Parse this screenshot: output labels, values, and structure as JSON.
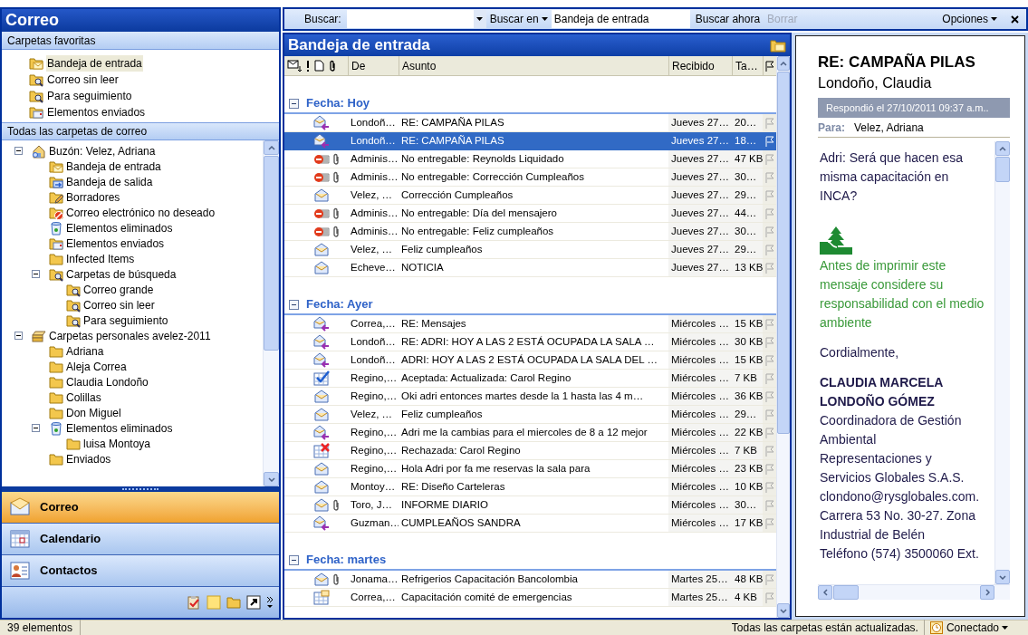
{
  "navigation_pane": {
    "title": "Correo",
    "favorites": {
      "title": "Carpetas favoritas",
      "items": [
        {
          "label": "Bandeja de entrada",
          "kind": "inbox",
          "selected": true
        },
        {
          "label": "Correo sin leer",
          "kind": "search",
          "selected": false
        },
        {
          "label": "Para seguimiento",
          "kind": "search",
          "selected": false
        },
        {
          "label": "Elementos enviados",
          "kind": "sent",
          "selected": false
        }
      ]
    },
    "all_folders": {
      "title": "Todas las carpetas de correo",
      "tree": [
        {
          "label": "Buzón: Velez, Adriana",
          "kind": "mailbox",
          "expanded": true,
          "children": [
            {
              "label": "Bandeja de entrada",
              "kind": "inbox"
            },
            {
              "label": "Bandeja de salida",
              "kind": "outbox"
            },
            {
              "label": "Borradores",
              "kind": "drafts"
            },
            {
              "label": "Correo electrónico no deseado",
              "kind": "junk"
            },
            {
              "label": "Elementos eliminados",
              "kind": "deleted"
            },
            {
              "label": "Elementos enviados",
              "kind": "sent"
            },
            {
              "label": "Infected Items",
              "kind": "folder"
            },
            {
              "label": "Carpetas de búsqueda",
              "kind": "search",
              "expanded": true,
              "children": [
                {
                  "label": "Correo grande",
                  "kind": "search"
                },
                {
                  "label": "Correo sin leer",
                  "kind": "search"
                },
                {
                  "label": "Para seguimiento",
                  "kind": "search"
                }
              ]
            }
          ]
        },
        {
          "label": "Carpetas personales avelez-2011",
          "kind": "pst",
          "expanded": true,
          "children": [
            {
              "label": "Adriana",
              "kind": "folder"
            },
            {
              "label": "Aleja Correa",
              "kind": "folder"
            },
            {
              "label": "Claudia Londoño",
              "kind": "folder"
            },
            {
              "label": "Colillas",
              "kind": "folder"
            },
            {
              "label": "Don Miguel",
              "kind": "folder"
            },
            {
              "label": "Elementos eliminados",
              "kind": "deleted",
              "expanded": true,
              "children": [
                {
                  "label": "luisa Montoya",
                  "kind": "folder"
                }
              ]
            },
            {
              "label": "Enviados",
              "kind": "folder"
            }
          ]
        }
      ]
    },
    "buttons": [
      {
        "label": "Correo",
        "kind": "mail",
        "selected": true
      },
      {
        "label": "Calendario",
        "kind": "calendar",
        "selected": false
      },
      {
        "label": "Contactos",
        "kind": "contacts",
        "selected": false
      }
    ]
  },
  "search_bar": {
    "label": "Buscar:",
    "scope_button": "Buscar en",
    "scope": "Bandeja de entrada",
    "search_now": "Buscar ahora",
    "clear": {
      "label": "Borrar",
      "disabled": true
    },
    "options": "Opciones"
  },
  "message_list": {
    "title": "Bandeja de entrada",
    "columns": [
      "De",
      "Asunto",
      "Recibido",
      "Ta…"
    ],
    "groups": [
      {
        "label": "Fecha: Hoy",
        "expanded": true,
        "rows": [
          {
            "kind": "reply",
            "attachment": false,
            "selected": false,
            "from": "Londoñ…",
            "subject": "RE: CAMPAÑA PILAS",
            "received": "Jueves 27…",
            "size": "20…"
          },
          {
            "kind": "reply",
            "attachment": false,
            "selected": true,
            "from": "Londoñ…",
            "subject": "RE: CAMPAÑA PILAS",
            "received": "Jueves 27…",
            "size": "18…"
          },
          {
            "kind": "ndr",
            "attachment": true,
            "selected": false,
            "from": "Adminis…",
            "subject": "No entregable: Reynolds Liquidado",
            "received": "Jueves 27…",
            "size": "47 KB"
          },
          {
            "kind": "ndr",
            "attachment": true,
            "selected": false,
            "from": "Adminis…",
            "subject": "No entregable: Corrección Cumpleaños",
            "received": "Jueves 27…",
            "size": "30…"
          },
          {
            "kind": "read",
            "attachment": false,
            "selected": false,
            "from": "Velez, …",
            "subject": "Corrección Cumpleaños",
            "received": "Jueves 27…",
            "size": "29…"
          },
          {
            "kind": "ndr",
            "attachment": true,
            "selected": false,
            "from": "Adminis…",
            "subject": "No entregable: Día del mensajero",
            "received": "Jueves 27…",
            "size": "44…"
          },
          {
            "kind": "ndr",
            "attachment": true,
            "selected": false,
            "from": "Adminis…",
            "subject": "No entregable: Feliz cumpleaños",
            "received": "Jueves 27…",
            "size": "30…"
          },
          {
            "kind": "read",
            "attachment": false,
            "selected": false,
            "from": "Velez, …",
            "subject": "Feliz cumpleaños",
            "received": "Jueves 27…",
            "size": "29…"
          },
          {
            "kind": "read",
            "attachment": false,
            "selected": false,
            "from": "Echeve…",
            "subject": "NOTICIA",
            "received": "Jueves 27…",
            "size": "13 KB"
          }
        ]
      },
      {
        "label": "Fecha: Ayer",
        "expanded": true,
        "rows": [
          {
            "kind": "reply",
            "attachment": false,
            "selected": false,
            "from": "Correa,…",
            "subject": "RE: Mensajes",
            "received": "Miércoles …",
            "size": "15 KB"
          },
          {
            "kind": "reply",
            "attachment": false,
            "selected": false,
            "from": "Londoñ…",
            "subject": "RE: ADRI: HOY A LAS 2 ESTÁ OCUPADA LA SALA …",
            "received": "Miércoles …",
            "size": "30 KB"
          },
          {
            "kind": "reply",
            "attachment": false,
            "selected": false,
            "from": "Londoñ…",
            "subject": "ADRI: HOY A LAS 2 ESTÁ OCUPADA LA SALA DEL …",
            "received": "Miércoles …",
            "size": "15 KB"
          },
          {
            "kind": "accepted",
            "attachment": false,
            "selected": false,
            "from": "Regino,…",
            "subject": "Aceptada: Actualizada: Carol Regino",
            "received": "Miércoles …",
            "size": "7 KB"
          },
          {
            "kind": "read",
            "attachment": false,
            "selected": false,
            "from": "Regino,…",
            "subject": "Oki adri entonces martes desde la 1 hasta las 4 m…",
            "received": "Miércoles …",
            "size": "36 KB"
          },
          {
            "kind": "read",
            "attachment": false,
            "selected": false,
            "from": "Velez, …",
            "subject": "Feliz cumpleaños",
            "received": "Miércoles …",
            "size": "29…"
          },
          {
            "kind": "reply",
            "attachment": false,
            "selected": false,
            "from": "Regino,…",
            "subject": "Adri me la cambias para el miercoles de 8 a 12 mejor",
            "received": "Miércoles …",
            "size": "22 KB"
          },
          {
            "kind": "declined",
            "attachment": false,
            "selected": false,
            "from": "Regino,…",
            "subject": "Rechazada: Carol Regino",
            "received": "Miércoles …",
            "size": "7 KB"
          },
          {
            "kind": "read",
            "attachment": false,
            "selected": false,
            "from": "Regino,…",
            "subject": "Hola Adri por fa me reservas la sala para",
            "received": "Miércoles …",
            "size": "23 KB"
          },
          {
            "kind": "read",
            "attachment": false,
            "selected": false,
            "from": "Montoy…",
            "subject": "RE: Diseño Carteleras",
            "received": "Miércoles …",
            "size": "10 KB"
          },
          {
            "kind": "read",
            "attachment": true,
            "selected": false,
            "from": "Toro, J…",
            "subject": "INFORME DIARIO",
            "received": "Miércoles …",
            "size": "30…"
          },
          {
            "kind": "reply",
            "attachment": false,
            "selected": false,
            "from": "Guzman…",
            "subject": "CUMPLEAÑOS SANDRA",
            "received": "Miércoles …",
            "size": "17 KB"
          }
        ]
      },
      {
        "label": "Fecha: martes",
        "expanded": true,
        "rows": [
          {
            "kind": "read",
            "attachment": true,
            "selected": false,
            "from": "Jonama…",
            "subject": "Refrigerios Capacitación Bancolombia",
            "received": "Martes 25…",
            "size": "48 KB"
          },
          {
            "kind": "meeting",
            "attachment": false,
            "selected": false,
            "from": "Correa,…",
            "subject": "Capacitación comité de emergencias",
            "received": "Martes 25…",
            "size": "4 KB"
          }
        ]
      }
    ]
  },
  "reading_pane": {
    "subject": "RE: CAMPAÑA PILAS",
    "sender": "Londoño, Claudia",
    "info": "Respondió el 27/10/2011 09:37 a.m..",
    "to_label": "Para:",
    "to": "Velez, Adriana",
    "body": [
      {
        "kind": "text",
        "text": "Adri: Será que hacen esa misma capacitación en INCA?"
      },
      {
        "kind": "eco",
        "text": "Antes de imprimir este mensaje considere su responsabilidad con el medio ambiente"
      },
      {
        "kind": "text",
        "text": "Cordialmente,"
      },
      {
        "kind": "name",
        "text": "CLAUDIA MARCELA LONDOÑO GÓMEZ"
      },
      {
        "kind": "line",
        "text": "Coordinadora de Gestión Ambiental"
      },
      {
        "kind": "line",
        "text": "Representaciones y Servicios Globales S.A.S."
      },
      {
        "kind": "line",
        "text": "clondono@rysglobales.com."
      },
      {
        "kind": "line",
        "text": "Carrera 53 No. 30-27. Zona Industrial de Belén"
      },
      {
        "kind": "line",
        "text": "Teléfono (574) 3500060 Ext."
      }
    ]
  },
  "status_bar": {
    "count": "39 elementos",
    "sync": "Todas las carpetas están actualizadas.",
    "connection": "Conectado"
  }
}
